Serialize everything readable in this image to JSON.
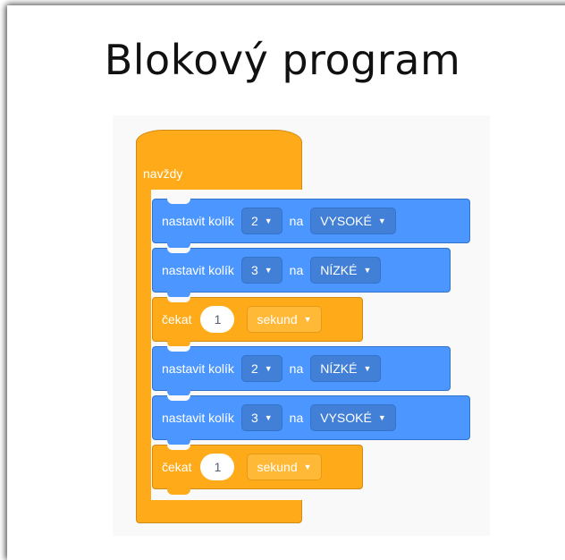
{
  "title": "Blokový program",
  "forever_label": "navždy",
  "blocks": [
    {
      "type": "pin",
      "label": "nastavit kolík",
      "pin": "2",
      "na": "na",
      "level": "VYSOKÉ"
    },
    {
      "type": "pin",
      "label": "nastavit kolík",
      "pin": "3",
      "na": "na",
      "level": "NÍZKÉ"
    },
    {
      "type": "wait",
      "label": "čekat",
      "value": "1",
      "unit": "sekund"
    },
    {
      "type": "pin",
      "label": "nastavit kolík",
      "pin": "2",
      "na": "na",
      "level": "NÍZKÉ"
    },
    {
      "type": "pin",
      "label": "nastavit kolík",
      "pin": "3",
      "na": "na",
      "level": "VYSOKÉ"
    },
    {
      "type": "wait",
      "label": "čekat",
      "value": "1",
      "unit": "sekund"
    }
  ],
  "dropdown_icon": "caret-down-icon",
  "colors": {
    "motion_blue": "#4c97ff",
    "control_orange": "#ffab19"
  }
}
